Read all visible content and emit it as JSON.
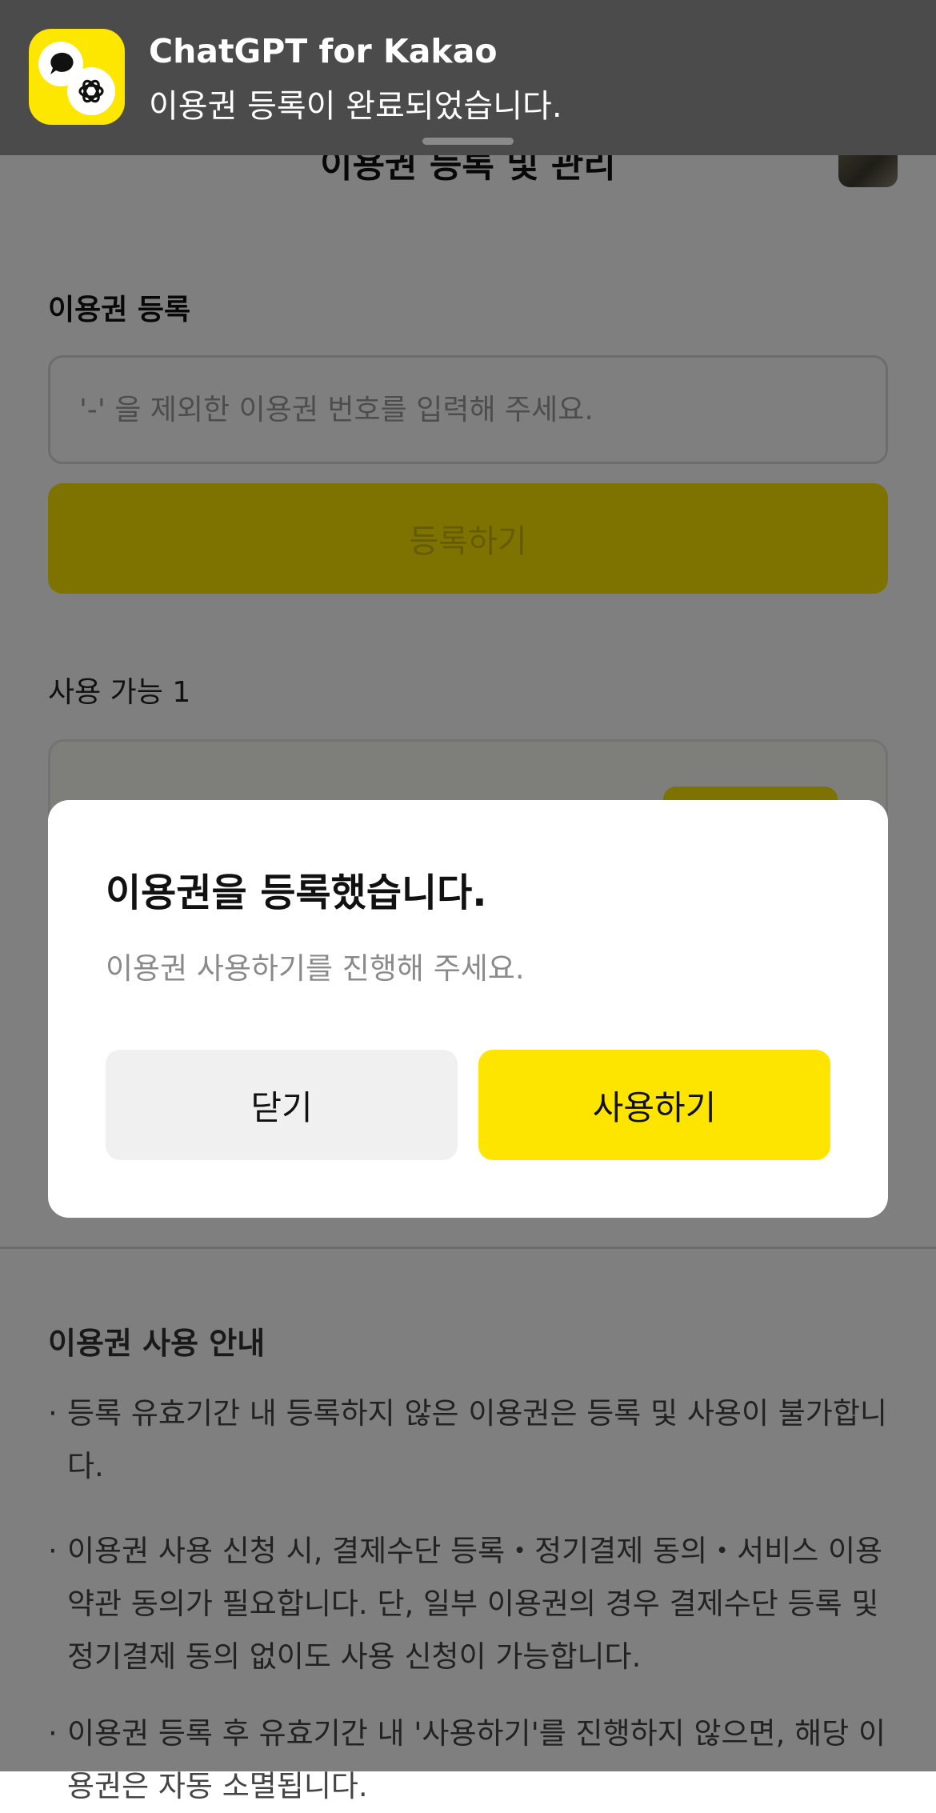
{
  "header": {
    "title": "이용권 등록 및 관리"
  },
  "register": {
    "section_label": "이용권 등록",
    "input_placeholder": "'-' 을 제외한 이용권 번호를 입력해 주세요.",
    "button_label": "등록하기"
  },
  "available": {
    "label": "사용 가능 1"
  },
  "guide": {
    "title": "이용권 사용 안내",
    "items": [
      "등록 유효기간 내 등록하지 않은 이용권은 등록 및 사용이 불가합니다.",
      "이용권 사용 신청 시, 결제수단 등록・정기결제 동의・서비스 이용약관 동의가 필요합니다. 단, 일부 이용권의 경우 결제수단 등록 및 정기결제 동의 없이도 사용 신청이 가능합니다.",
      "이용권 등록 후 유효기간 내 '사용하기'를 진행하지 않으면, 해당 이용권은 자동 소멸됩니다."
    ]
  },
  "notification": {
    "app_name": "ChatGPT for Kakao",
    "message": "이용권 등록이 완료되었습니다.",
    "icon": "chatgpt-kakao-app-icon"
  },
  "dialog": {
    "title": "이용권을 등록했습니다.",
    "message": "이용권 사용하기를 진행해 주세요.",
    "close_label": "닫기",
    "use_label": "사용하기"
  },
  "colors": {
    "accent_yellow": "#FEE500",
    "notification_bg": "#4B4B4B",
    "secondary_button": "#F0F0F0"
  }
}
